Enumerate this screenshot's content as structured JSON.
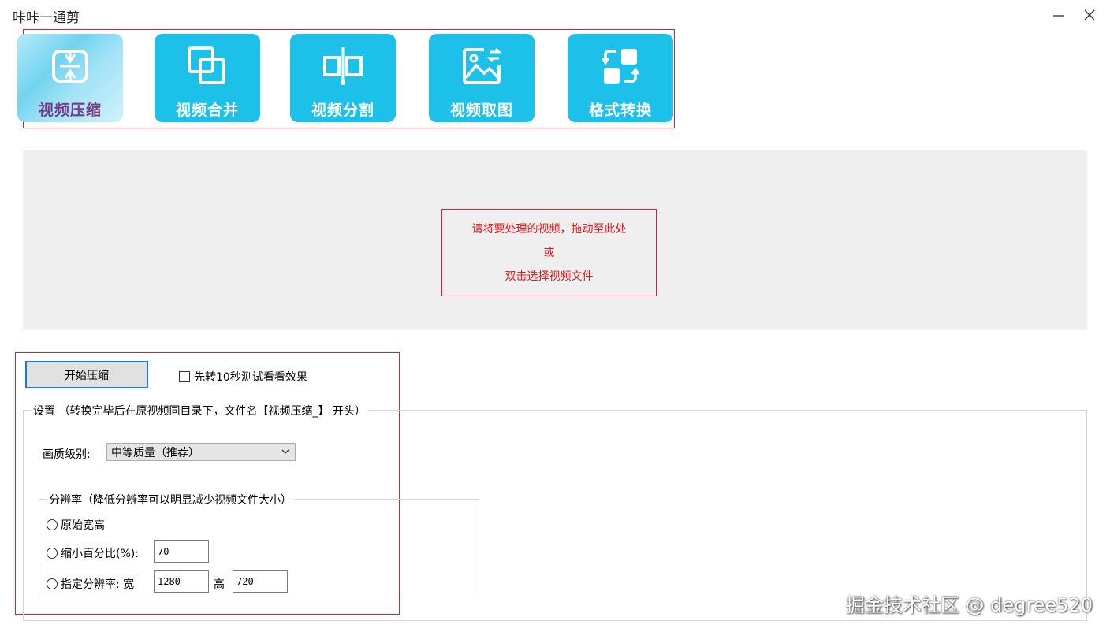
{
  "window": {
    "title": "咔咔一通剪"
  },
  "toolbar": {
    "items": [
      {
        "label": "视频压缩",
        "icon": "compress-icon",
        "active": true
      },
      {
        "label": "视频合并",
        "icon": "merge-icon",
        "active": false
      },
      {
        "label": "视频分割",
        "icon": "split-icon",
        "active": false
      },
      {
        "label": "视频取图",
        "icon": "image-capture-icon",
        "active": false
      },
      {
        "label": "格式转换",
        "icon": "format-convert-icon",
        "active": false
      }
    ]
  },
  "dropzone": {
    "line1": "请将要处理的视频，拖动至此处",
    "line2": "或",
    "line3": "双击选择视频文件"
  },
  "controls": {
    "start_label": "开始压缩",
    "trial_label": "先转10秒测试看看效果",
    "trial_checked": false
  },
  "settings": {
    "legend": "设置 （转换完毕后在原视频同目录下，文件名【视频压缩_】 开头）",
    "quality_label": "画质级别:",
    "quality_value": "中等质量（推荐）",
    "resolution": {
      "legend": "分辨率（降低分辨率可以明显减少视频文件大小）",
      "option_original": "原始宽高",
      "option_percent": "缩小百分比(%):",
      "percent_value": "70",
      "option_specify": "指定分辨率: 宽",
      "width_value": "1280",
      "height_label": "高",
      "height_value": "720"
    }
  },
  "watermark": "掘金技术社区 @ degree520",
  "colors": {
    "tool_bg": "#1cc0e8",
    "highlight_red": "#d9212f",
    "drop_text": "#e8141b"
  }
}
